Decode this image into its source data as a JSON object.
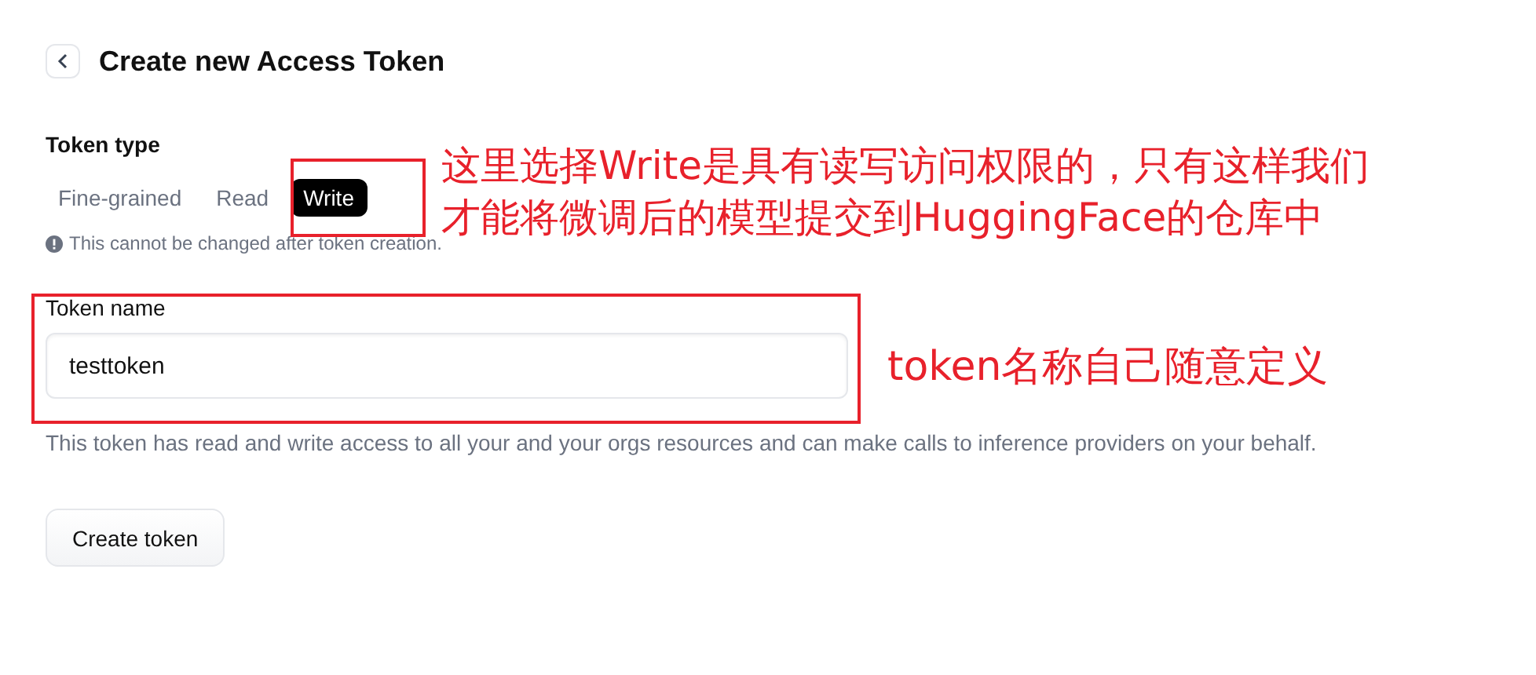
{
  "header": {
    "title": "Create new Access Token"
  },
  "token_type": {
    "label": "Token type",
    "tabs": [
      {
        "label": "Fine-grained",
        "selected": false
      },
      {
        "label": "Read",
        "selected": false
      },
      {
        "label": "Write",
        "selected": true
      }
    ],
    "note": "This cannot be changed after token creation."
  },
  "token_name": {
    "label": "Token name",
    "value": "testtoken"
  },
  "description": "This token has read and write access to all your and your orgs resources and can make calls to inference providers on your behalf.",
  "button": "Create token",
  "annotations": [
    {
      "kind": "tabs",
      "lines": [
        "这里选择Write是具有读写访问权限的，只有这样我们",
        "才能将微调后的模型提交到HuggingFace的仓库中"
      ],
      "color": "#e8212b"
    },
    {
      "kind": "field",
      "lines": [
        "token名称自己随意定义"
      ],
      "color": "#e8212b"
    }
  ]
}
